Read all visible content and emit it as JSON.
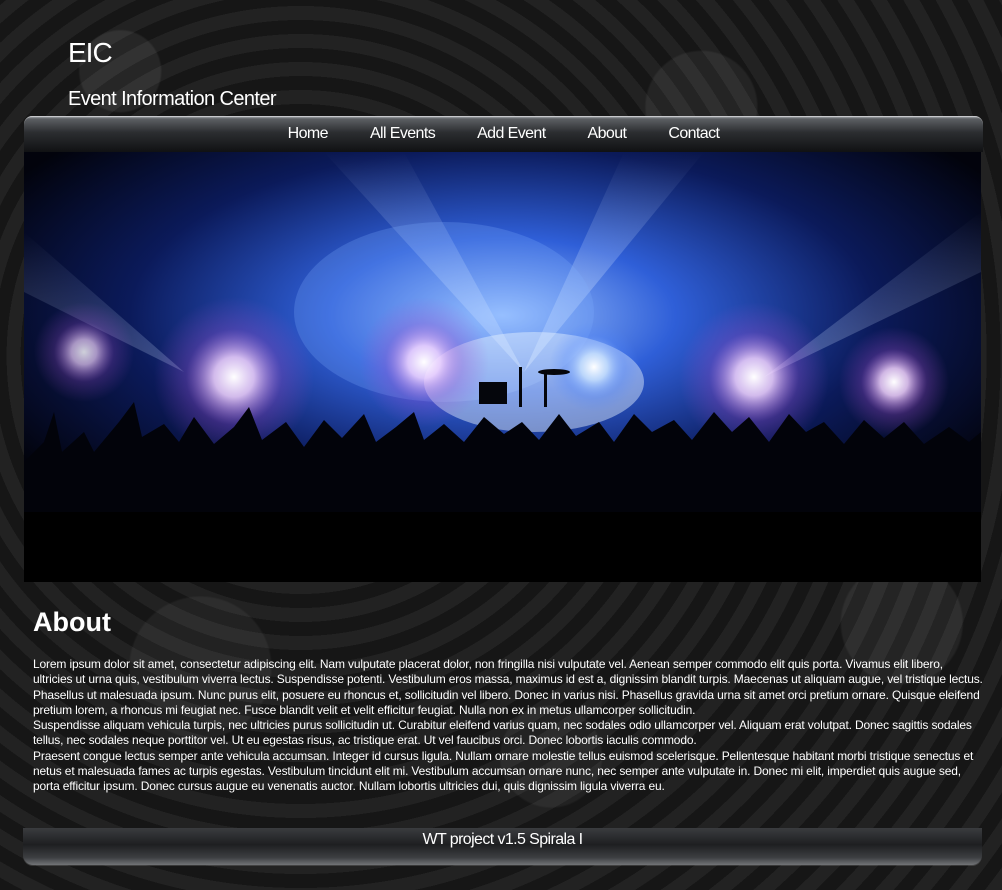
{
  "header": {
    "logo": "EIC",
    "subtitle": "Event Information Center"
  },
  "nav": {
    "items": [
      {
        "label": "Home"
      },
      {
        "label": "All Events"
      },
      {
        "label": "Add Event"
      },
      {
        "label": "About"
      },
      {
        "label": "Contact"
      }
    ]
  },
  "about": {
    "title": "About",
    "paragraphs": [
      "Lorem ipsum dolor sit amet, consectetur adipiscing elit. Nam vulputate placerat dolor, non fringilla nisi vulputate vel. Aenean semper commodo elit quis porta. Vivamus elit libero, ultricies ut urna quis, vestibulum viverra lectus. Suspendisse potenti. Vestibulum eros massa, maximus id est a, dignissim blandit turpis. Maecenas ut aliquam augue, vel tristique lectus. Phasellus ut malesuada ipsum. Nunc purus elit, posuere eu rhoncus et, sollicitudin vel libero. Donec in varius nisi. Phasellus gravida urna sit amet orci pretium ornare. Quisque eleifend pretium lorem, a rhoncus mi feugiat nec. Fusce blandit velit et velit efficitur feugiat. Nulla non ex in metus ullamcorper sollicitudin.",
      "Suspendisse aliquam vehicula turpis, nec ultricies purus sollicitudin ut. Curabitur eleifend varius quam, nec sodales odio ullamcorper vel. Aliquam erat volutpat. Donec sagittis sodales tellus, nec sodales neque porttitor vel. Ut eu egestas risus, ac tristique erat. Ut vel faucibus orci. Donec lobortis iaculis commodo.",
      "Praesent congue lectus semper ante vehicula accumsan. Integer id cursus ligula. Nullam ornare molestie tellus euismod scelerisque. Pellentesque habitant morbi tristique senectus et netus et malesuada fames ac turpis egestas. Vestibulum tincidunt elit mi. Vestibulum accumsan ornare nunc, nec semper ante vulputate in. Donec mi elit, imperdiet quis augue sed, porta efficitur ipsum. Donec cursus augue eu venenatis auctor. Nullam lobortis ultricies dui, quis dignissim ligula viverra eu."
    ]
  },
  "footer": {
    "text": "WT project v1.5 Spirala I"
  }
}
